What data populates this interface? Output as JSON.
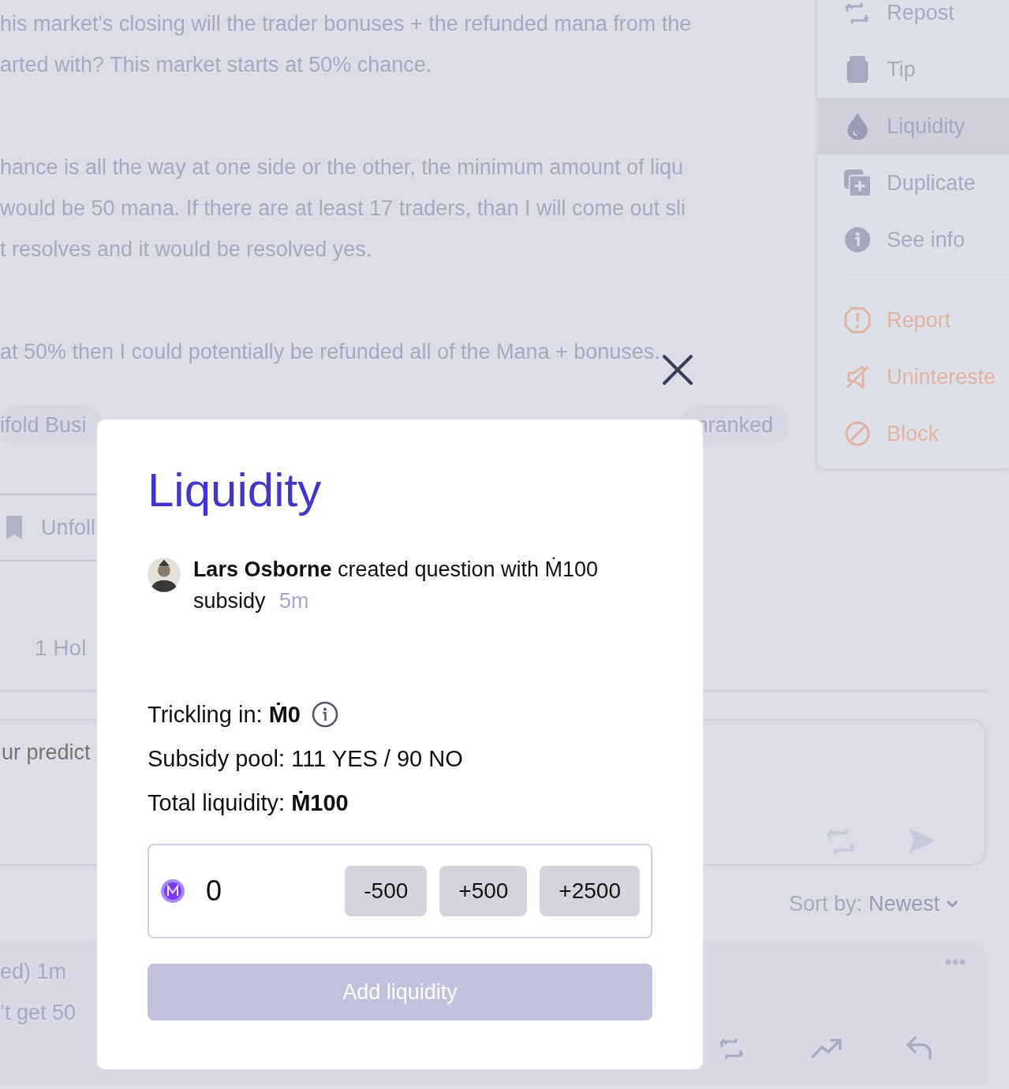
{
  "background": {
    "description_paragraphs": [
      [
        "his market's closing will the trader bonuses + the refunded mana from the",
        "arted with? This market starts at 50% chance."
      ],
      [
        "hance is all the way at one side or the other, the minimum amount of liqu",
        "would be 50 mana. If there are at least 17 traders, than I will come out sli",
        "t resolves and it would be resolved yes."
      ],
      [
        "at 50% then I could potentially be refunded all of the Mana + bonuses."
      ]
    ],
    "tags": [
      "ifold Busi",
      "nranked"
    ],
    "follow_button": "Unfoll",
    "holders_tab": "1 Hol",
    "comment_placeholder": "ur predict",
    "sort": {
      "label": "Sort by:",
      "value": "Newest"
    },
    "comment": {
      "meta": "ed) 1m",
      "text": "’t get 50"
    }
  },
  "menu": {
    "items": [
      {
        "label": "Repost",
        "kind": "normal",
        "selected": false
      },
      {
        "label": "Tip",
        "kind": "normal",
        "selected": false
      },
      {
        "label": "Liquidity",
        "kind": "normal",
        "selected": true
      },
      {
        "label": "Duplicate",
        "kind": "normal",
        "selected": false
      },
      {
        "label": "See info",
        "kind": "normal",
        "selected": false
      },
      {
        "label": "Report",
        "kind": "danger",
        "selected": false
      },
      {
        "label": "Unintereste",
        "kind": "danger",
        "selected": false
      },
      {
        "label": "Block",
        "kind": "danger",
        "selected": false
      }
    ]
  },
  "modal": {
    "title": "Liquidity",
    "activity": {
      "text": "**Lars Osborne** created question with Ṁ100 subsidy",
      "time": "5m"
    },
    "stats": [
      {
        "label": "Trickling in:",
        "value": "Ṁ0",
        "info": true
      },
      {
        "label": "Subsidy pool: 111 YES / 90 NO"
      },
      {
        "label": "Total liquidity:",
        "value": "Ṁ100"
      }
    ],
    "amount": {
      "value": "0"
    },
    "quick_buttons": [
      "-500",
      "+500",
      "+2500"
    ],
    "submit": {
      "label": "Add liquidity",
      "disabled": true
    }
  }
}
